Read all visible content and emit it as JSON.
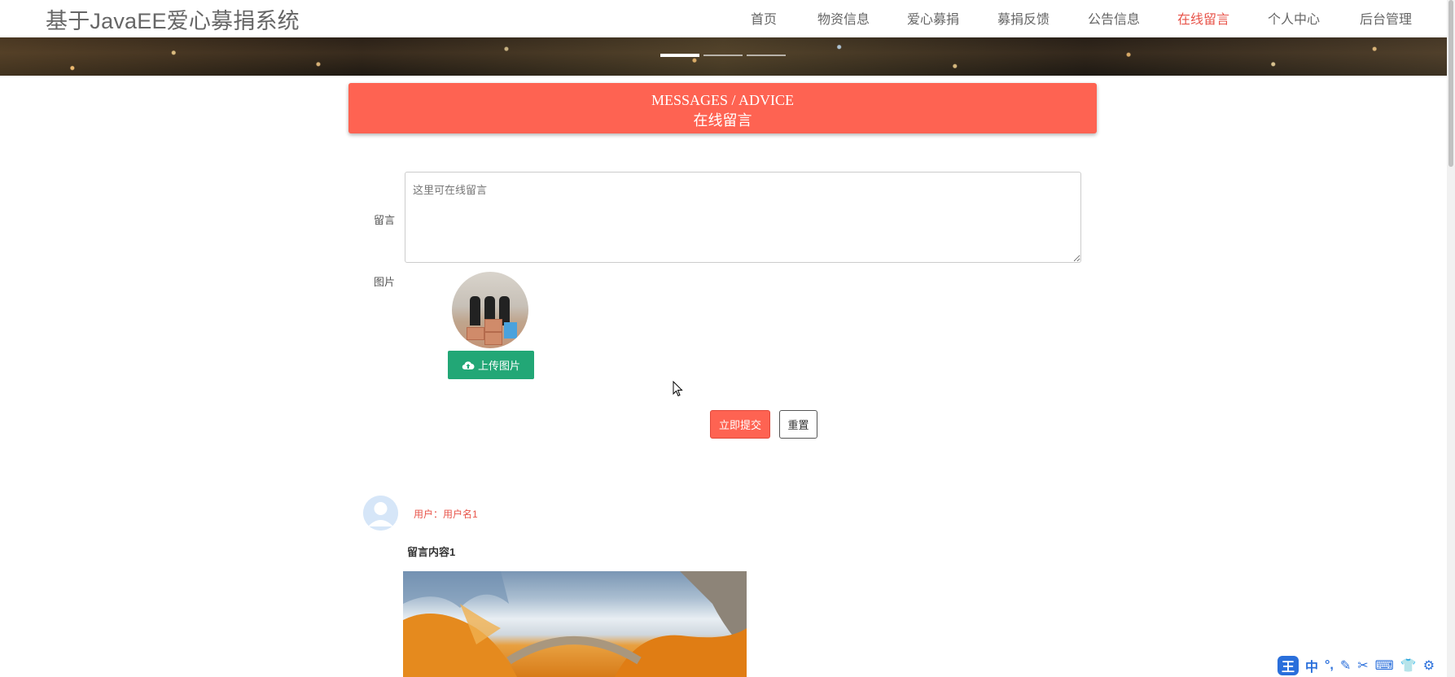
{
  "brand": "基于JavaEE爱心募捐系统",
  "nav": {
    "items": [
      {
        "label": "首页"
      },
      {
        "label": "物资信息"
      },
      {
        "label": "爱心募捐"
      },
      {
        "label": "募捐反馈"
      },
      {
        "label": "公告信息"
      },
      {
        "label": "在线留言",
        "active": true
      },
      {
        "label": "个人中心"
      },
      {
        "label": "后台管理"
      }
    ]
  },
  "banner": {
    "indicators": 3,
    "active_index": 0
  },
  "section": {
    "title_en": "MESSAGES / ADVICE",
    "title_cn": "在线留言"
  },
  "form": {
    "message_label": "留言",
    "message_placeholder": "这里可在线留言",
    "image_label": "图片",
    "upload_label": "上传图片",
    "submit_label": "立即提交",
    "reset_label": "重置"
  },
  "messages": [
    {
      "user": "用户：用户名1",
      "content": "留言内容1"
    }
  ],
  "ime": {
    "logo": "王",
    "mode": "中"
  },
  "colors": {
    "accent": "#fe6352",
    "active_nav": "#e8544a",
    "upload_button": "#22a776"
  }
}
